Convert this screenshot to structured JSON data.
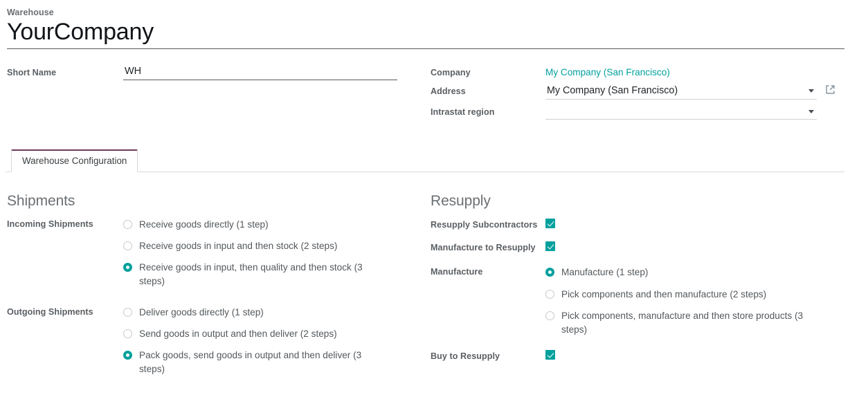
{
  "header": {
    "breadcrumb": "Warehouse",
    "title": "YourCompany"
  },
  "form": {
    "short_name_label": "Short Name",
    "short_name_value": "WH",
    "company_label": "Company",
    "company_value": "My Company (San Francisco)",
    "address_label": "Address",
    "address_value": "My Company (San Francisco)",
    "intrastat_label": "Intrastat region",
    "intrastat_value": ""
  },
  "tabs": [
    {
      "label": "Warehouse Configuration",
      "active": true
    }
  ],
  "shipments": {
    "section_title": "Shipments",
    "incoming": {
      "label": "Incoming Shipments",
      "options": [
        {
          "label": "Receive goods directly (1 step)",
          "selected": false
        },
        {
          "label": "Receive goods in input and then stock (2 steps)",
          "selected": false
        },
        {
          "label": "Receive goods in input, then quality and then stock (3 steps)",
          "selected": true
        }
      ]
    },
    "outgoing": {
      "label": "Outgoing Shipments",
      "options": [
        {
          "label": "Deliver goods directly (1 step)",
          "selected": false
        },
        {
          "label": "Send goods in output and then deliver (2 steps)",
          "selected": false
        },
        {
          "label": "Pack goods, send goods in output and then deliver (3 steps)",
          "selected": true
        }
      ]
    }
  },
  "resupply": {
    "section_title": "Resupply",
    "subcontractors": {
      "label": "Resupply Subcontractors",
      "checked": true
    },
    "manufacture_to_resupply": {
      "label": "Manufacture to Resupply",
      "checked": true
    },
    "manufacture": {
      "label": "Manufacture",
      "options": [
        {
          "label": "Manufacture (1 step)",
          "selected": true
        },
        {
          "label": "Pick components and then manufacture (2 steps)",
          "selected": false
        },
        {
          "label": "Pick components, manufacture and then store products (3 steps)",
          "selected": false
        }
      ]
    },
    "buy_to_resupply": {
      "label": "Buy to Resupply",
      "checked": true
    }
  },
  "colors": {
    "accent_teal": "#00a09d",
    "tab_accent": "#6b3a5b",
    "label_grey": "#5b5f63"
  }
}
